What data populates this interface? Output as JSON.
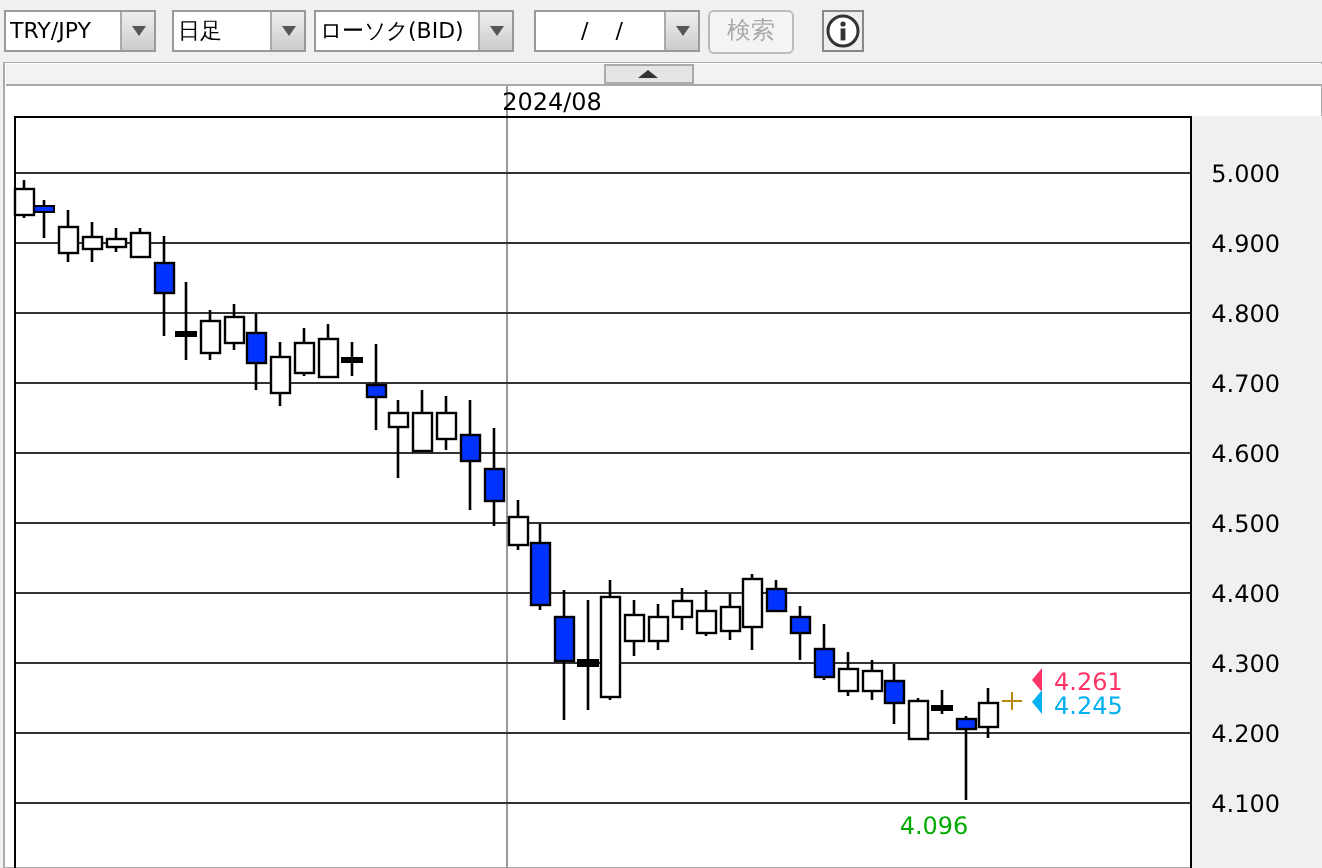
{
  "toolbar": {
    "pair_select": {
      "value": "TRY/JPY"
    },
    "period_select": {
      "value": "日足"
    },
    "chart_type_select": {
      "value": "ローソク(BID)"
    },
    "date_select": {
      "value": "/ /"
    },
    "search_button": {
      "label": "検索",
      "disabled": true
    }
  },
  "chart": {
    "date_label": "2024/08",
    "y_labels": [
      "5.000",
      "4.900",
      "4.800",
      "4.700",
      "4.600",
      "4.500",
      "4.400",
      "4.300",
      "4.200",
      "4.100"
    ],
    "price_markers": [
      {
        "label": "4.261",
        "color": "#ff3366"
      },
      {
        "label": "4.245",
        "color": "#00b0f0"
      }
    ],
    "low_label": "4.096"
  }
}
